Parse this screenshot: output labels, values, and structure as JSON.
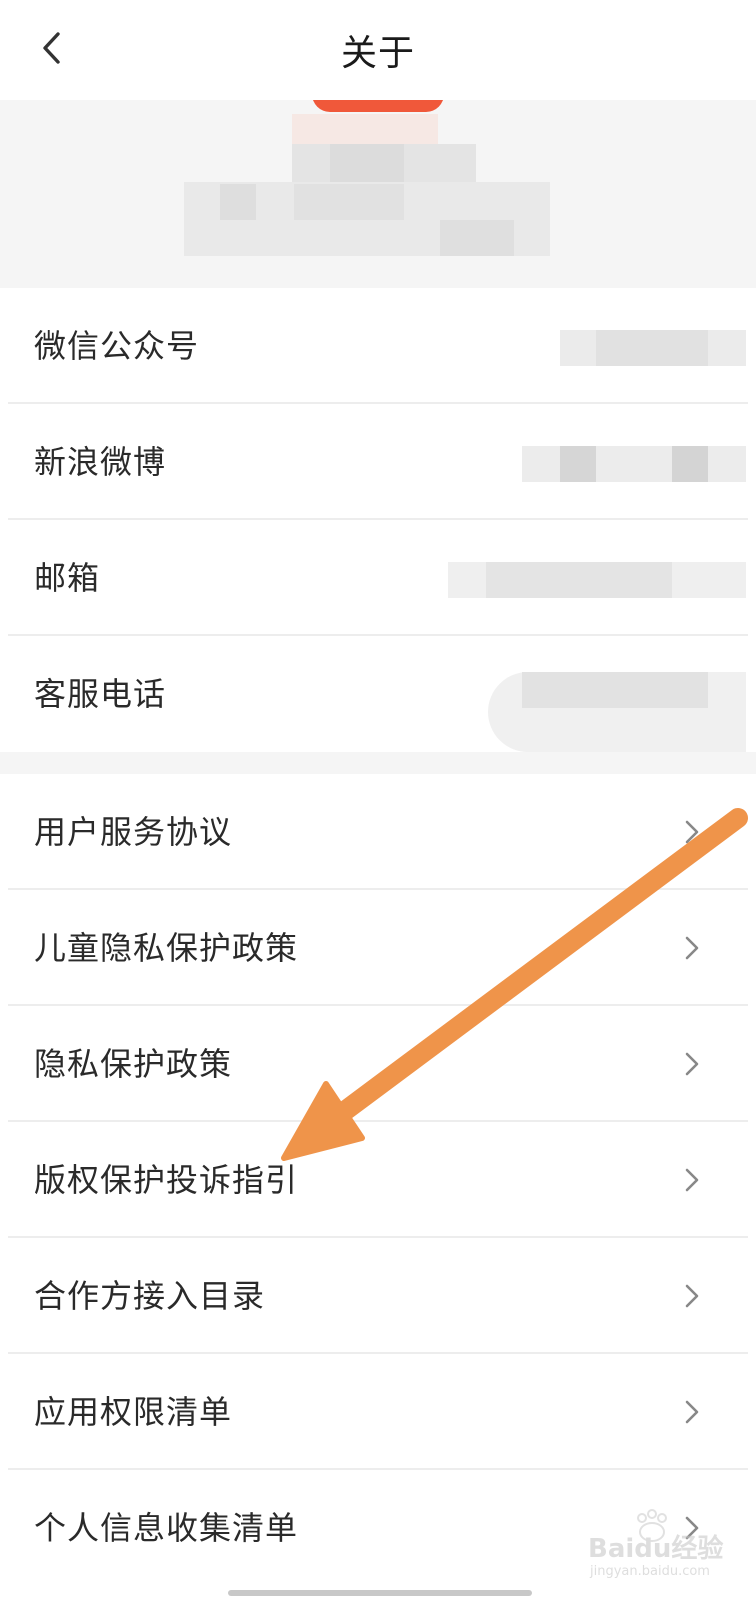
{
  "header": {
    "title": "关于",
    "back_icon": "chevron-left-icon"
  },
  "contact_rows": [
    {
      "label": "微信公众号"
    },
    {
      "label": "新浪微博"
    },
    {
      "label": "邮箱"
    },
    {
      "label": "客服电话"
    }
  ],
  "link_rows": [
    {
      "label": "用户服务协议"
    },
    {
      "label": "儿童隐私保护政策"
    },
    {
      "label": "隐私保护政策"
    },
    {
      "label": "版权保护投诉指引"
    },
    {
      "label": "合作方接入目录"
    },
    {
      "label": "应用权限清单"
    },
    {
      "label": "个人信息收集清单"
    }
  ],
  "colors": {
    "brand_orange": "#f0583a",
    "annotation_arrow": "#ef944a",
    "background_gray": "#f5f5f5"
  },
  "icons": {
    "row_chevron": "chevron-right-icon"
  },
  "watermark": {
    "brand": "Baidu经验",
    "url": "jingyan.baidu.com"
  }
}
